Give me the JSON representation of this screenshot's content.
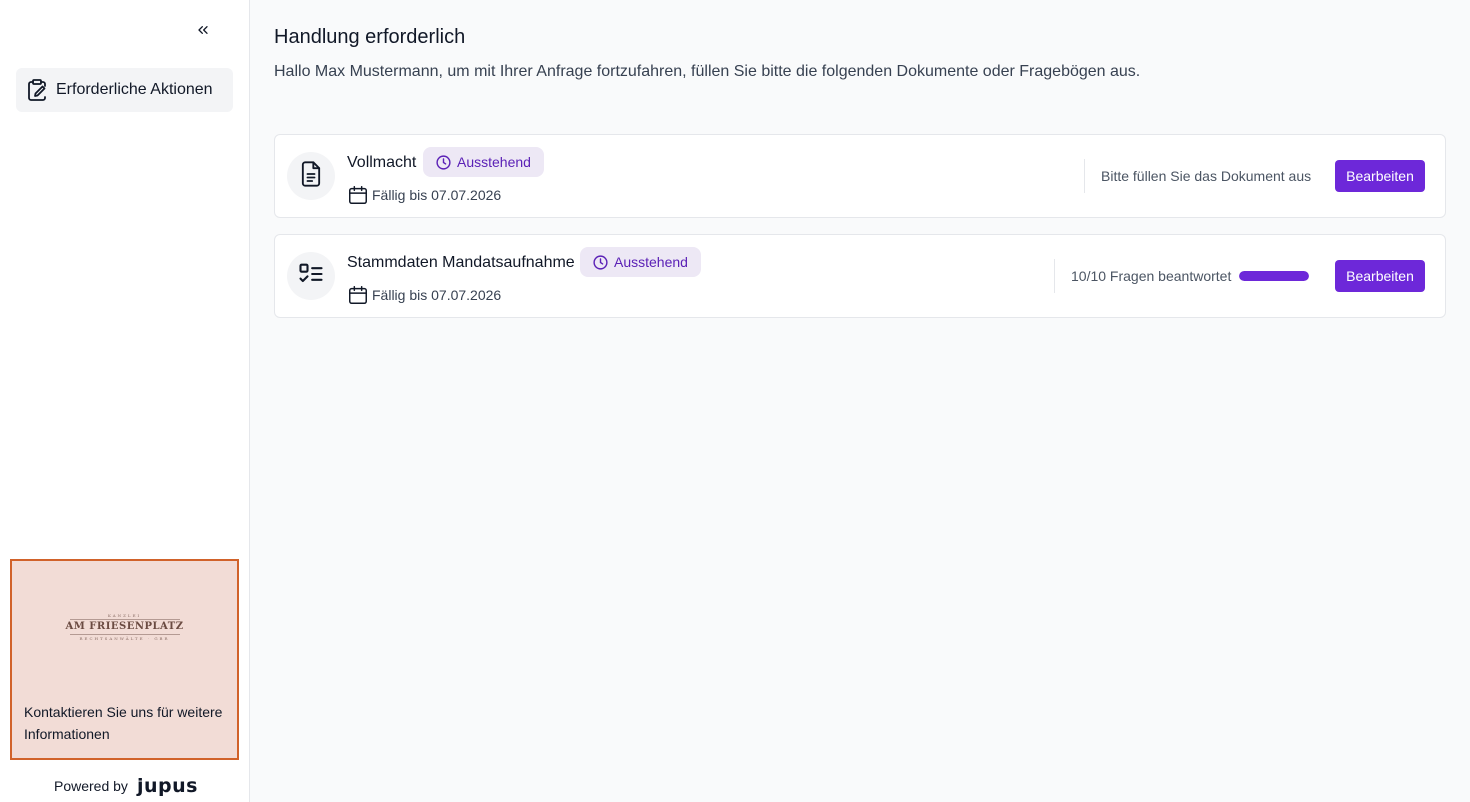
{
  "sidebar": {
    "collapse_icon": "chevrons-left-icon",
    "nav_items": [
      {
        "label": "Erforderliche Aktionen",
        "icon": "clipboard-signature-icon",
        "active": true
      }
    ],
    "contact": {
      "logo_top": "KANZLEI",
      "logo_name": "AM FRIESENPLATZ",
      "logo_bottom": "RECHTSANWÄLTE · GBR",
      "text": "Kontaktieren Sie uns für weitere Informationen",
      "border_color": "#d1622a",
      "background": "#f2dcd6"
    },
    "powered_by": "Powered by",
    "brand": "jupus"
  },
  "main": {
    "title": "Handlung erforderlich",
    "subtitle": "Hallo Max Mustermann, um mit Ihrer Anfrage fortzufahren, füllen Sie bitte die folgenden Dokumente oder Fragebögen aus."
  },
  "tasks": [
    {
      "icon": "document-icon",
      "name": "Vollmacht",
      "status": "Ausstehend",
      "due": "Fällig bis 07.07.2026",
      "info": "Bitte füllen Sie das Dokument aus",
      "button": "Bearbeiten"
    },
    {
      "icon": "checklist-icon",
      "name": "Stammdaten Mandatsaufnahme",
      "status": "Ausstehend",
      "due": "Fällig bis 07.07.2026",
      "info": "10/10 Fragen beantwortet",
      "progress": 1.0,
      "button": "Bearbeiten"
    }
  ],
  "colors": {
    "accent": "#6d28d9",
    "badge_bg": "#ede8f5",
    "badge_text": "#5b21b6"
  }
}
